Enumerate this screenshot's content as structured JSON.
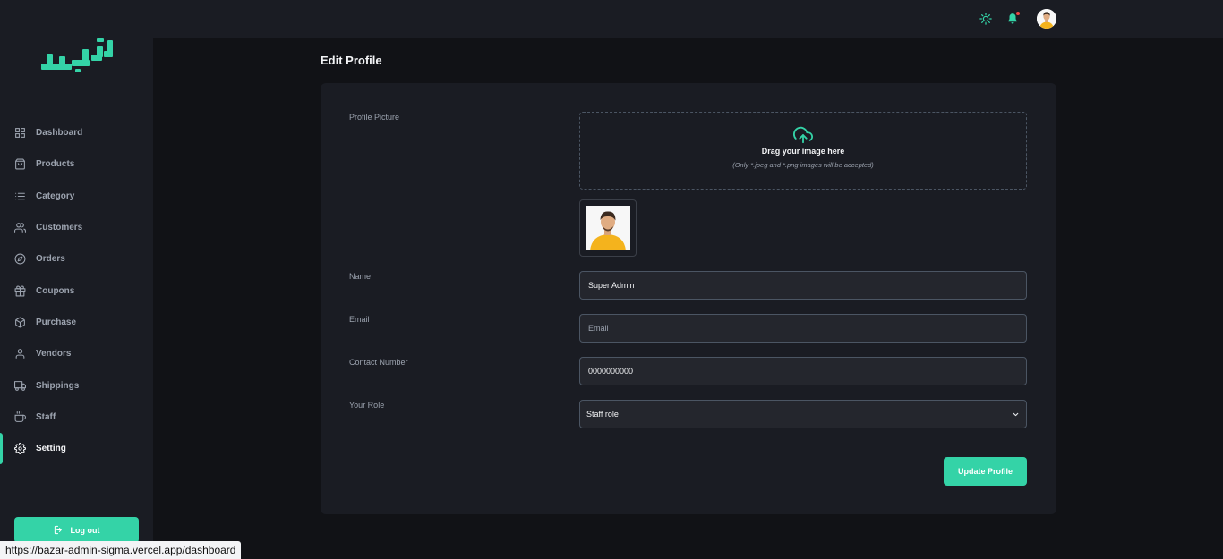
{
  "theme": {
    "accent": "#34d3a7",
    "background": "#111216",
    "panel": "#1a1c23",
    "notification": "#ef4444"
  },
  "header": {
    "icons": [
      "sun-icon",
      "bell-icon",
      "avatar"
    ]
  },
  "brand": {
    "logo_text": "خریدلو"
  },
  "sidebar": {
    "items": [
      {
        "label": "Dashboard",
        "icon": "grid-icon"
      },
      {
        "label": "Products",
        "icon": "shopping-bag-icon"
      },
      {
        "label": "Category",
        "icon": "list-icon"
      },
      {
        "label": "Customers",
        "icon": "users-icon"
      },
      {
        "label": "Orders",
        "icon": "compass-icon"
      },
      {
        "label": "Coupons",
        "icon": "gift-icon"
      },
      {
        "label": "Purchase",
        "icon": "box-icon"
      },
      {
        "label": "Vendors",
        "icon": "user-icon"
      },
      {
        "label": "Shippings",
        "icon": "truck-icon"
      },
      {
        "label": "Staff",
        "icon": "coffee-icon"
      },
      {
        "label": "Setting",
        "icon": "gear-icon",
        "active": true
      }
    ],
    "logout_label": "Log out"
  },
  "main": {
    "title": "Edit Profile",
    "form": {
      "picture_label": "Profile Picture",
      "dropzone_title": "Drag your image here",
      "dropzone_hint": "(Only *.jpeg and *.png images will be accepted)",
      "name_label": "Name",
      "name_value": "Super Admin",
      "email_label": "Email",
      "email_value": "",
      "email_placeholder": "Email",
      "contact_label": "Contact Number",
      "contact_value": "0000000000",
      "role_label": "Your Role",
      "role_value": "Staff role",
      "submit_label": "Update Profile"
    }
  },
  "statusbar": {
    "url": "https://bazar-admin-sigma.vercel.app/dashboard"
  }
}
